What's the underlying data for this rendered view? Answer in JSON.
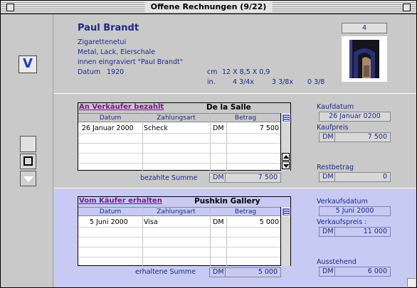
{
  "window": {
    "title": "Offene Rechnungen (9/22)"
  },
  "nav": {
    "v_button": "V"
  },
  "item": {
    "artist": "Paul Brandt",
    "desc1": "Zigarettenetui",
    "desc2": "Metal, Lack, Eierschale",
    "desc3": "innen eingraviert \"Paul Brandt\"",
    "datum_label": "Datum",
    "datum_value": "1920",
    "dim_cm_unit": "cm",
    "dim_cm_value": "12 X 8,5 X 0,9",
    "dim_in_unit": "in.",
    "dim_in_1": "4 3/4x",
    "dim_in_2": "3 3/8x",
    "dim_in_3": "0 3/8",
    "counter": "4"
  },
  "purchase": {
    "link": "An Verkäufer bezahlt",
    "party": "De la Salle",
    "columns": [
      "Datum",
      "Zahlungsart",
      "Betrag"
    ],
    "rows": [
      {
        "datum": "26 Januar 2000",
        "art": "Scheck",
        "cur": "DM",
        "betrag": "7 500"
      }
    ],
    "sum_label": "bezahlte Summe",
    "sum_cur": "DM",
    "sum_value": "7 500",
    "kaufdatum_label": "Kaufdatum",
    "kaufdatum_value": "26 Januar 0200",
    "kaufpreis_label": "Kaufpreis",
    "kaufpreis_cur": "DM",
    "kaufpreis_value": "7 500",
    "rest_label": "Restbetrag",
    "rest_cur": "DM",
    "rest_value": "0"
  },
  "sale": {
    "link": "Vom Käufer erhalten",
    "party": "Pushkin Gallery",
    "columns": [
      "Datum",
      "Zahlungsart",
      "Betrag"
    ],
    "rows": [
      {
        "datum": "5 Juni 2000",
        "art": "Visa",
        "cur": "DM",
        "betrag": "5 000"
      }
    ],
    "sum_label": "erhaltene Summe",
    "sum_cur": "DM",
    "sum_value": "5 000",
    "vdatum_label": "Verkaufsdatum",
    "vdatum_value": "5 Juni 2000",
    "vpreis_label": "Verkaufspreis :",
    "vpreis_cur": "DM",
    "vpreis_value": "11 000",
    "aus_label": "Ausstehend",
    "aus_cur": "DM",
    "aus_value": "6 000"
  },
  "colors": {
    "accent_blue": "#1c3fbf",
    "link_purple": "#7a1a8a",
    "sale_bg": "#c7cbf3",
    "panel_gray": "#c9c9c9"
  },
  "icons": [
    "close-box-icon",
    "zoom-box-icon",
    "v-icon",
    "square-icon",
    "down-triangle-icon",
    "list-menu-icon",
    "scroll-up-arrow-icon",
    "scroll-down-arrow-icon",
    "resize-grip-icon"
  ]
}
